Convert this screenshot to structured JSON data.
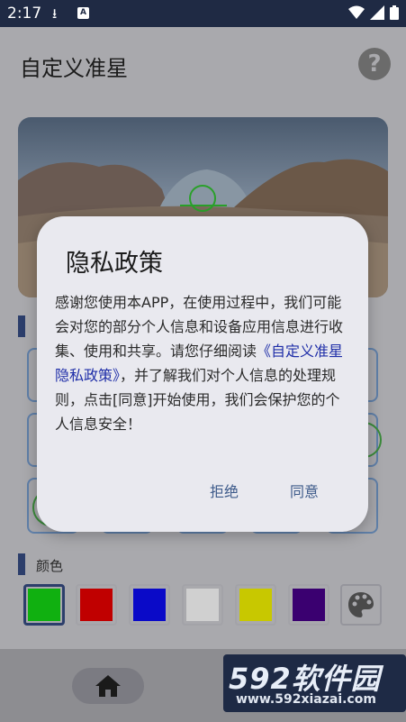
{
  "status_bar": {
    "time": "2:17"
  },
  "app": {
    "title": "自定义准星",
    "help_icon": "help-circle-icon"
  },
  "sections": {
    "color_label": "颜色"
  },
  "colors": {
    "swatches": [
      "#10b010",
      "#c00000",
      "#0a0ac8",
      "#d0d0d0",
      "#c8c800",
      "#3a0070"
    ],
    "selected_index": 0
  },
  "dialog": {
    "title": "隐私政策",
    "body_before_link": "感谢您使用本APP，在使用过程中，我们可能会对您的部分个人信息和设备应用信息进行收集、使用和共享。请您仔细阅读",
    "link_text": "《自定义准星隐私政策》",
    "body_after_link": "，并了解我们对个人信息的处理规则，点击[同意]开始使用，我们会保护您的个人信息安全！",
    "reject_label": "拒绝",
    "agree_label": "同意"
  },
  "watermark": {
    "brand": "592软件园",
    "url": "www.592xiazai.com"
  }
}
